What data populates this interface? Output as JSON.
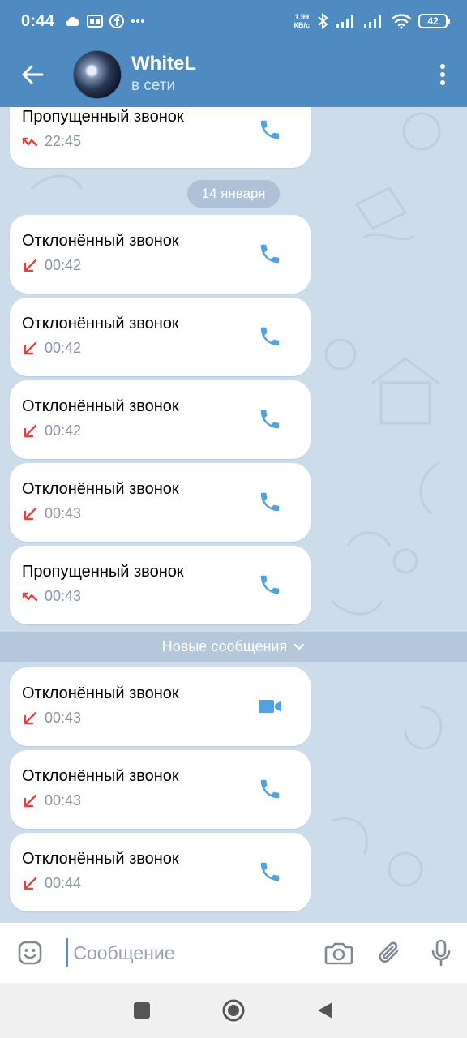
{
  "status_bar": {
    "time": "0:44",
    "speed_value": "1.99",
    "speed_unit": "КБ/с",
    "battery": "42",
    "icons": [
      "cloud-icon",
      "sim-icon",
      "facebook-icon",
      "more-dots-icon",
      "bluetooth-icon",
      "signal-icon",
      "signal-icon",
      "wifi-icon",
      "battery-icon"
    ]
  },
  "header": {
    "title": "WhiteL",
    "status": "в сети"
  },
  "chat": {
    "top_message": {
      "title": "Пропущенный звонок",
      "time": "22:45",
      "type": "missed",
      "media": "phone"
    },
    "date_separator": "14 января",
    "messages_before": [
      {
        "title": "Отклонённый звонок",
        "time": "00:42",
        "type": "declined",
        "media": "phone"
      },
      {
        "title": "Отклонённый звонок",
        "time": "00:42",
        "type": "declined",
        "media": "phone"
      },
      {
        "title": "Отклонённый звонок",
        "time": "00:42",
        "type": "declined",
        "media": "phone"
      },
      {
        "title": "Отклонённый звонок",
        "time": "00:43",
        "type": "declined",
        "media": "phone"
      },
      {
        "title": "Пропущенный звонок",
        "time": "00:43",
        "type": "missed",
        "media": "phone"
      }
    ],
    "new_messages_label": "Новые сообщения",
    "messages_after": [
      {
        "title": "Отклонённый звонок",
        "time": "00:43",
        "type": "declined",
        "media": "video"
      },
      {
        "title": "Отклонённый звонок",
        "time": "00:43",
        "type": "declined",
        "media": "phone"
      },
      {
        "title": "Отклонённый звонок",
        "time": "00:44",
        "type": "declined",
        "media": "phone"
      }
    ]
  },
  "input": {
    "placeholder": "Сообщение"
  },
  "colors": {
    "header": "#4f8bc0",
    "accent": "#4fa3e0",
    "call_red": "#e0443e",
    "background": "#cddcea"
  }
}
